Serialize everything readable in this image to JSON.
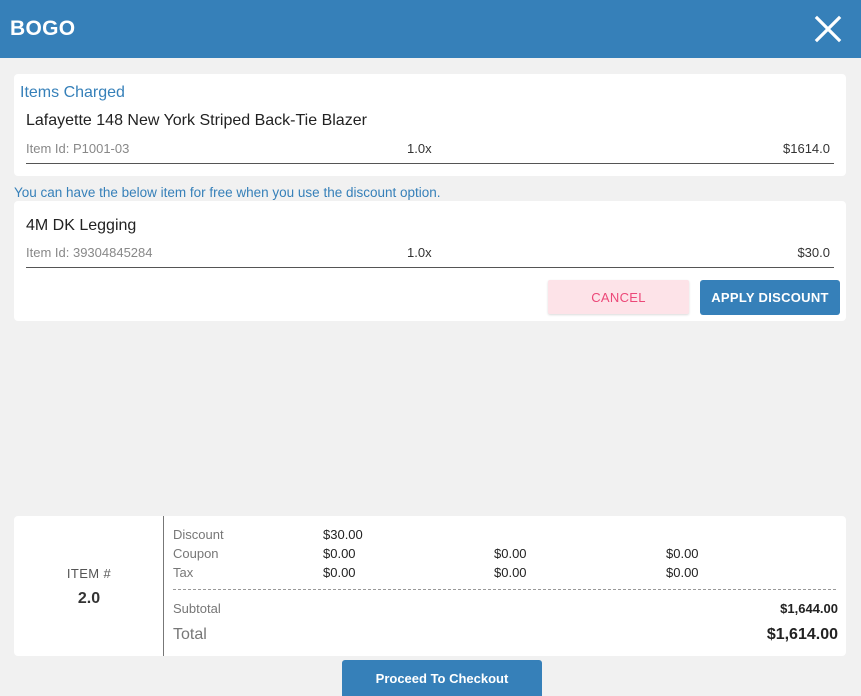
{
  "header": {
    "title": "BOGO",
    "close_icon": "close-icon"
  },
  "charged": {
    "title": "Items Charged",
    "item": {
      "name": "Lafayette 148 New York Striped Back-Tie Blazer",
      "id": "Item Id: P1001-03",
      "qty": "1.0x",
      "price": "$1614.0"
    }
  },
  "free_note": "You can have the below item for free when you use the discount option.",
  "free": {
    "item": {
      "name": "4M DK Legging",
      "id": "Item Id: 39304845284",
      "qty": "1.0x",
      "price": "$30.0"
    },
    "cancel_label": "CANCEL",
    "apply_label": "APPLY DISCOUNT"
  },
  "summary": {
    "item_label": "ITEM #",
    "item_count": "2.0",
    "discount": {
      "label": "Discount",
      "v1": "$30.00"
    },
    "coupon": {
      "label": "Coupon",
      "v1": "$0.00",
      "v2": "$0.00",
      "v3": "$0.00"
    },
    "tax": {
      "label": "Tax",
      "v1": "$0.00",
      "v2": "$0.00",
      "v3": "$0.00"
    },
    "subtotal": {
      "label": "Subtotal",
      "value": "$1,644.00"
    },
    "total": {
      "label": "Total",
      "value": "$1,614.00"
    }
  },
  "checkout_label": "Proceed To Checkout",
  "colors": {
    "primary": "#3680b9",
    "cancel_bg": "#fde3e8",
    "cancel_text": "#ec4878"
  }
}
